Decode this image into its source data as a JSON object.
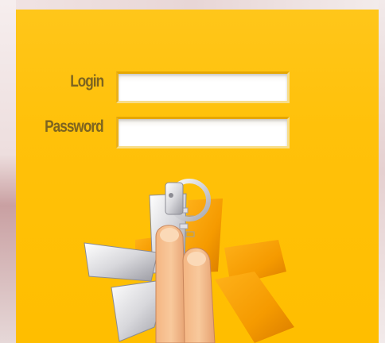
{
  "form": {
    "login_label": "Login",
    "login_value": "",
    "password_label": "Password",
    "password_value": ""
  },
  "colors": {
    "panel": "#ffc10a",
    "label": "#7d6420",
    "field": "#ffffff"
  },
  "icons": {
    "graphic": "zipper-asterisk-logo-icon"
  }
}
